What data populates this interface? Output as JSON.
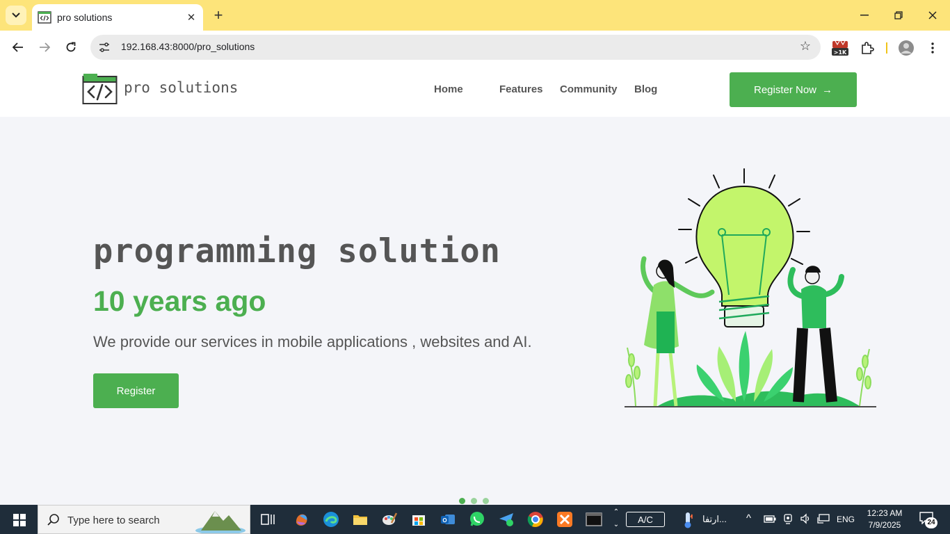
{
  "browser": {
    "tab_title": "pro solutions",
    "url": "192.168.43:8000/pro_solutions",
    "extension_badge": ">1K"
  },
  "site": {
    "brand": "pro solutions",
    "nav": [
      "Home",
      "Features",
      "Community",
      "Blog"
    ],
    "cta_label": "Register Now",
    "cta_arrow": "→"
  },
  "hero": {
    "title": "programming solution",
    "subtitle": "10 years ago",
    "description": "We provide our services in mobile applications , websites and AI.",
    "button_label": "Register",
    "slide_count": 3,
    "active_slide": 1
  },
  "taskbar": {
    "search_placeholder": "Type here to search",
    "ac_label": "A/C",
    "weather_text": "ارتفا...",
    "language": "ENG",
    "time": "12:23 AM",
    "date": "7/9/2025",
    "notifications": "24"
  },
  "colors": {
    "accent": "#4caf50",
    "tabstrip": "#fde47a",
    "taskbar": "#1f2d3a"
  }
}
